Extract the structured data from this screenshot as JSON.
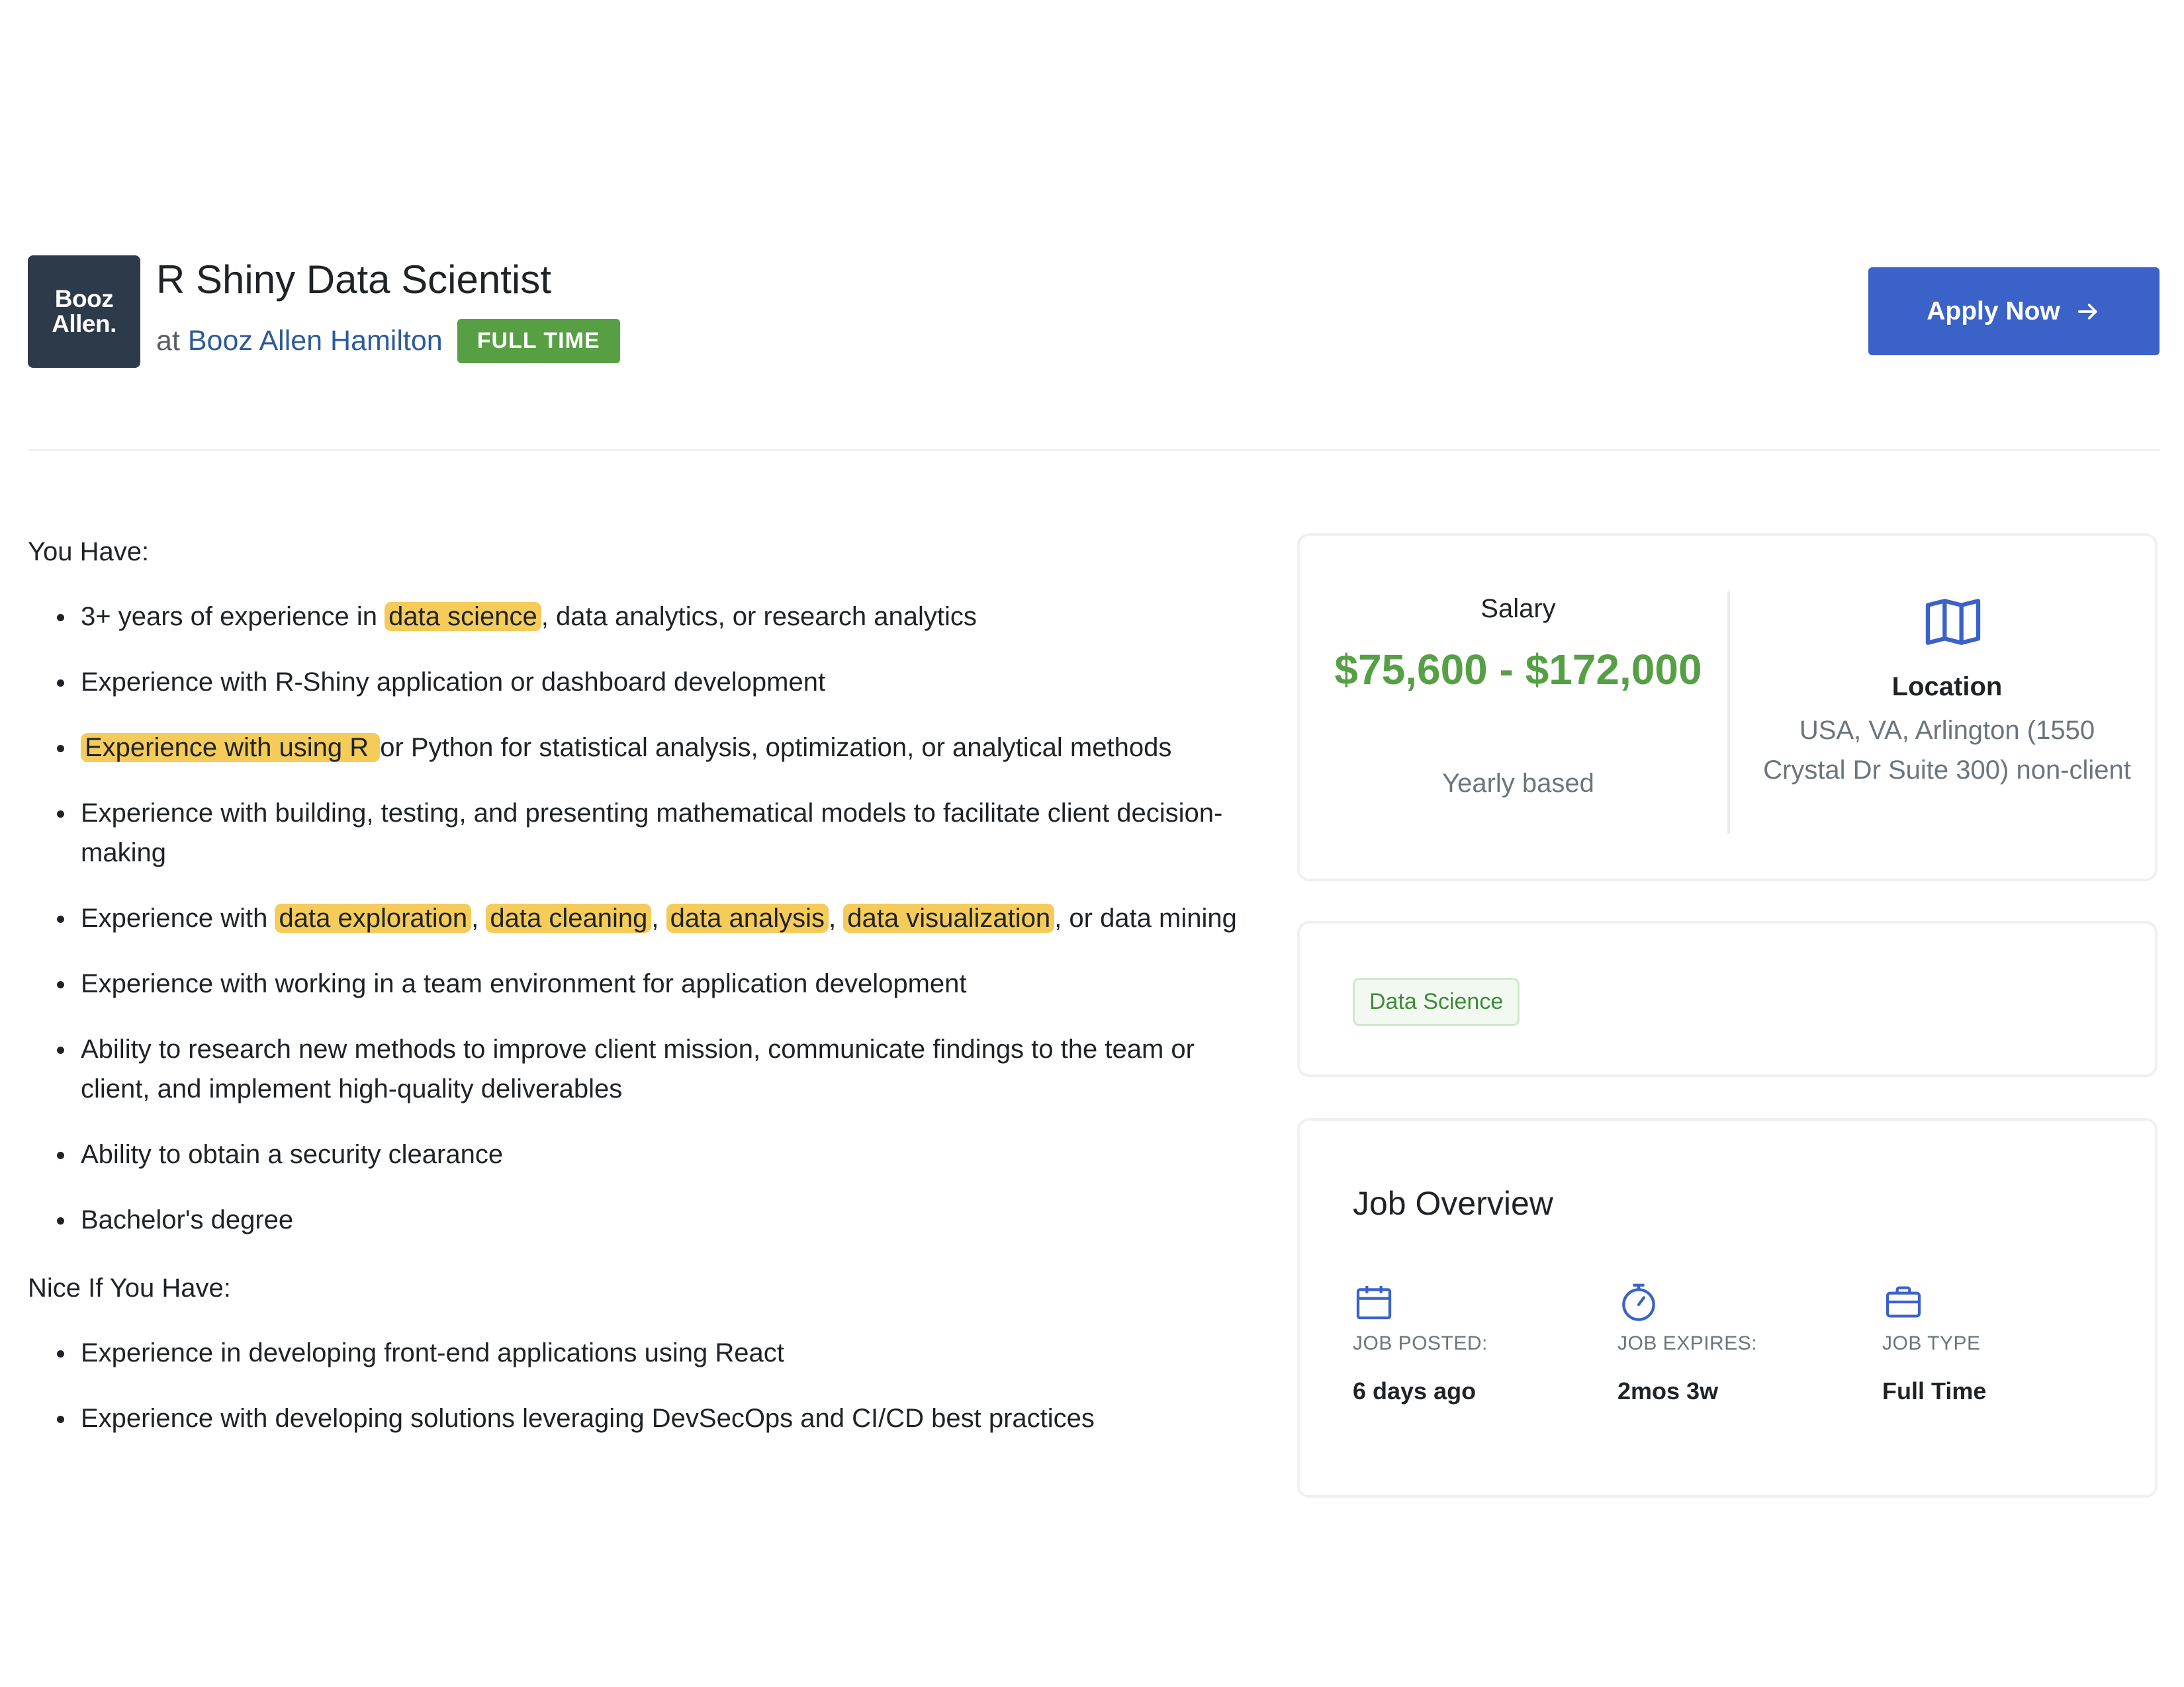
{
  "header": {
    "logo_text": [
      "Booz",
      "Allen."
    ],
    "title": "R Shiny Data Scientist",
    "at_word": "at",
    "company": "Booz Allen Hamilton",
    "job_type_badge": "FULL TIME",
    "apply_label": "Apply Now",
    "apply_icon": "arrow-right-icon"
  },
  "description": {
    "you_have_heading": "You Have:",
    "you_have": [
      [
        {
          "t": "3+ years of experience in "
        },
        {
          "t": "data science",
          "hl": true
        },
        {
          "t": ", data analytics, or research analytics"
        }
      ],
      [
        {
          "t": "Experience with R-Shiny application or dashboard development"
        }
      ],
      [
        {
          "t": "Experience with using R ",
          "hl": true
        },
        {
          "t": "or Python for statistical analysis, optimization, or analytical methods"
        }
      ],
      [
        {
          "t": "Experience with building, testing, and presenting mathematical models to facilitate client decision-making"
        }
      ],
      [
        {
          "t": "Experience with "
        },
        {
          "t": "data exploration",
          "hl": true
        },
        {
          "t": ", "
        },
        {
          "t": "data cleaning",
          "hl": true
        },
        {
          "t": ", "
        },
        {
          "t": "data analysis",
          "hl": true
        },
        {
          "t": ", "
        },
        {
          "t": "data visualization",
          "hl": true
        },
        {
          "t": ", or data mining"
        }
      ],
      [
        {
          "t": "Experience with working in a team environment for application development"
        }
      ],
      [
        {
          "t": "Ability to research new methods to improve client mission, communicate findings to the team or client, and implement high-quality deliverables"
        }
      ],
      [
        {
          "t": "Ability to obtain a security clearance"
        }
      ],
      [
        {
          "t": "Bachelor's degree"
        }
      ]
    ],
    "nice_heading": "Nice If You Have:",
    "nice_to_have": [
      [
        {
          "t": "Experience in developing front-end applications using React"
        }
      ],
      [
        {
          "t": "Experience with developing solutions leveraging DevSecOps and CI/CD best practices"
        }
      ]
    ],
    "highlight_color": "#f5cb59"
  },
  "salary_card": {
    "salary_label": "Salary",
    "salary_value": "$75,600 - $172,000",
    "salary_basis": "Yearly based",
    "location_icon": "map-icon",
    "location_label": "Location",
    "location_value": "USA, VA, Arlington (1550 Crystal Dr Suite 300) non-client"
  },
  "tags": [
    "Data Science"
  ],
  "overview": {
    "title": "Job Overview",
    "items": [
      {
        "icon": "calendar-icon",
        "label": "JOB POSTED:",
        "value": "6 days ago"
      },
      {
        "icon": "stopwatch-icon",
        "label": "JOB EXPIRES:",
        "value": "2mos 3w"
      },
      {
        "icon": "briefcase-icon",
        "label": "JOB TYPE",
        "value": "Full Time"
      }
    ]
  },
  "colors": {
    "primary": "#3a62c9",
    "success": "#56a043",
    "salary": "#55a044",
    "link": "#2d5b9a",
    "logo_bg": "#2d3a49"
  }
}
